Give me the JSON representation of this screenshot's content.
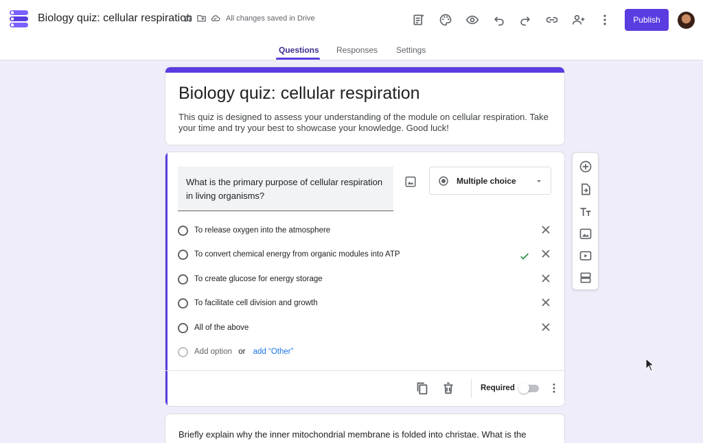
{
  "header": {
    "doc_title": "Biology quiz: cellular respiration",
    "save_status": "All changes saved in Drive",
    "publish_label": "Publish",
    "toolbar_icons": [
      "customize-icon",
      "palette-icon",
      "preview-icon",
      "undo-icon",
      "redo-icon",
      "link-icon",
      "add-collaborator-icon",
      "more-vert-icon"
    ]
  },
  "tabs": [
    {
      "label": "Questions",
      "active": true
    },
    {
      "label": "Responses",
      "active": false
    },
    {
      "label": "Settings",
      "active": false
    }
  ],
  "form": {
    "title": "Biology quiz: cellular respiration",
    "description": "This quiz is designed to assess your understanding of the module on cellular respiration. Take your time and try your best to showcase your knowledge. Good luck!"
  },
  "question": {
    "text": "What is the primary purpose of cellular respiration in living organisms?",
    "type": "Multiple choice",
    "options": [
      {
        "label": "To release oxygen into the atmosphere",
        "correct": false
      },
      {
        "label": "To convert chemical energy from organic modules into ATP",
        "correct": true
      },
      {
        "label": "To create glucose for energy storage",
        "correct": false
      },
      {
        "label": "To facilitate cell division and growth",
        "correct": false
      },
      {
        "label": "All of the above",
        "correct": false
      }
    ],
    "add_option": "Add option",
    "or": "or",
    "add_other": "add “Other”",
    "required_label": "Required",
    "required": false
  },
  "side_toolbar": [
    "add-question-icon",
    "import-questions-icon",
    "add-title-icon",
    "add-image-icon",
    "add-video-icon",
    "add-section-icon"
  ],
  "next_question": {
    "text": "Briefly explain why the inner mitochondrial membrane is folded into christae. What is the"
  },
  "colors": {
    "accent": "#5b3ce0",
    "background": "#efedf9",
    "correct": "#1e8e3e",
    "link": "#1a73e8"
  }
}
